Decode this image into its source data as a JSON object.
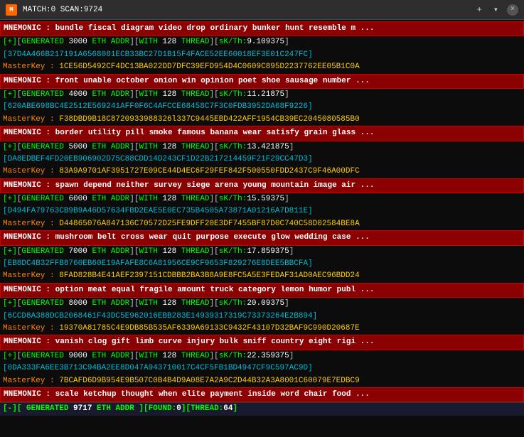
{
  "titleBar": {
    "icon": "M",
    "title": "MATCH:0 SCAN:9724",
    "closeLabel": "×",
    "plusLabel": "+",
    "chevronLabel": "▾"
  },
  "lines": [
    {
      "type": "mnemonic",
      "text": "MNEMONIC : bundle fiscal diagram video drop ordinary bunker hunt resemble m ..."
    },
    {
      "type": "generated",
      "text": "[+][GENERATED 3000 ETH ADDR][WITH 128 THREAD][sK/Th:9.109375]"
    },
    {
      "type": "address",
      "text": "[37D4A466B217191A6568081ECB33BC27D1B15F4FACE52EE60018EF3E01C247FC]"
    },
    {
      "type": "masterkey",
      "label": "MasterKey : ",
      "value": "1CE56D5492CF4DC13BA022DD7DFC39EFD954D4C0609C895D2237762EE05B1C0A"
    },
    {
      "type": "mnemonic",
      "text": "MNEMONIC : front unable october onion win opinion poet shoe sausage number ..."
    },
    {
      "type": "generated",
      "text": "[+][GENERATED 4000 ETH ADDR][WITH 128 THREAD][sK/Th:11.21875]"
    },
    {
      "type": "address",
      "text": "[620ABE698BC4E2512E569241AFF0F6C4AFCCE68458C7F3C0FDB3952DA68F9226]"
    },
    {
      "type": "masterkey",
      "label": "MasterKey : ",
      "value": "F38DBD9B18C8720933988326l337C9445EBD422AFF1954CB39EC2045080585B0"
    },
    {
      "type": "mnemonic",
      "text": "MNEMONIC : border utility pill smoke famous banana wear satisfy grain glass ..."
    },
    {
      "type": "generated",
      "text": "[+][GENERATED 5000 ETH ADDR][WITH 128 THREAD][sK/Th:13.421875]"
    },
    {
      "type": "address",
      "text": "[DA8EDBEF4FD20EB906902D75C88CDD14D243CF1D22B217214459F21F29CC47D3]"
    },
    {
      "type": "masterkey",
      "label": "MasterKey : ",
      "value": "83A9A9701AF3951727E09CE44D4EC6F29FEF842F500550FDD2437C9F46A00DFC"
    },
    {
      "type": "mnemonic",
      "text": "MNEMONIC : spawn depend neither survey siege arena young mountain image air ..."
    },
    {
      "type": "generated",
      "text": "[+][GENERATED 6000 ETH ADDR][WITH 128 THREAD][sK/Th:15.59375]"
    },
    {
      "type": "address",
      "text": "[D494FA79763CB9B9A46D57634FBD2EAE5E0EC735B4505A73871A01216A7D811E]"
    },
    {
      "type": "masterkey",
      "label": "MasterKey : ",
      "value": "D44865076A847136C70572D25FE9DFF20E3DF7455BF87D0C740C58D02584BE8A"
    },
    {
      "type": "mnemonic",
      "text": "MNEMONIC : mushroom belt cross wear quit purpose execute glow wedding case ..."
    },
    {
      "type": "generated",
      "text": "[+][GENERATED 7000 ETH ADDR][WITH 128 THREAD][sK/Th:17.859375]"
    },
    {
      "type": "address",
      "text": "[EB8DC4B32FFB8760EB60E19AFAFE8C6A81956CE9CF9653F829276E8DEE5BBCFA]"
    },
    {
      "type": "masterkey",
      "label": "MasterKey : ",
      "value": "8FAD828B4E41AEF2397151CDBBB2BA3B8A9E8FC5A5E3FEDAF31AD0AEC96BDD24"
    },
    {
      "type": "mnemonic",
      "text": "MNEMONIC : option meat equal fragile amount truck category lemon humor publ ..."
    },
    {
      "type": "generated",
      "text": "[+][GENERATED 8000 ETH ADDR][WITH 128 THREAD][sK/Th:20.09375]"
    },
    {
      "type": "address",
      "text": "[6CCD8A388DCB2068461F43DC5E962016EBB283E14939317319C73373264E2B894]"
    },
    {
      "type": "masterkey",
      "label": "MasterKey : ",
      "value": "19370A81785C4E9DB85B535AF6339A69133C9432F43107D32BAF9C990D20687E"
    },
    {
      "type": "mnemonic",
      "text": "MNEMONIC : vanish clog gift limb curve injury bulk sniff country eight rigi ..."
    },
    {
      "type": "generated",
      "text": "[+][GENERATED 9000 ETH ADDR][WITH 128 THREAD][sK/Th:22.359375]"
    },
    {
      "type": "address",
      "text": "[0DA333FA6EE3B713C94BA2EE8D047A943710017C4CF5FB1BD4947CF9C597AC9D]"
    },
    {
      "type": "masterkey",
      "label": "MasterKey : ",
      "value": "7BCAFD6D9B954E9B507C0B4B4D9A08E7A2A9C2D44B32A3A8001C60079E7EDBC9"
    },
    {
      "type": "mnemonic",
      "text": "MNEMONIC : scale ketchup thought when elite payment inside word chair food ..."
    },
    {
      "type": "status",
      "text": "[-][ GENERATED 9717 ETH ADDR ][FOUND:0][THREAD:64]"
    }
  ],
  "statusBar": {
    "generated": "9717",
    "found": "0",
    "thread": "64"
  }
}
